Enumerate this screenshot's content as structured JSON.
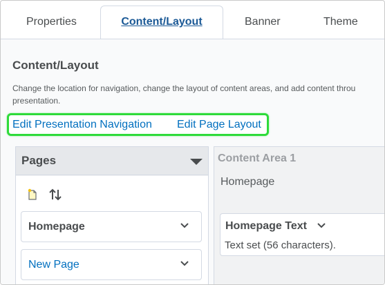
{
  "tabs": [
    {
      "label": "Properties"
    },
    {
      "label": "Content/Layout"
    },
    {
      "label": "Banner"
    },
    {
      "label": "Theme"
    }
  ],
  "section": {
    "title": "Content/Layout",
    "description_line1": "Change the location for navigation, change the layout of content areas, and add content throu",
    "description_line2": "presentation."
  },
  "links": {
    "edit_navigation": "Edit Presentation Navigation",
    "edit_layout": "Edit Page Layout"
  },
  "pages_panel": {
    "title": "Pages",
    "items": [
      {
        "label": "Homepage"
      },
      {
        "label": "New Page"
      }
    ]
  },
  "content_area": {
    "title": "Content Area 1",
    "subtitle": "Homepage",
    "widget": {
      "title": "Homepage Text",
      "text": "Text set (56 characters)."
    }
  },
  "colors": {
    "accent_link": "#006fbf",
    "active_tab": "#1b5996",
    "highlight": "#2edb3a"
  },
  "icons": [
    "new-page-icon",
    "reorder-icon",
    "chevron-down-icon",
    "caret-down-icon"
  ]
}
